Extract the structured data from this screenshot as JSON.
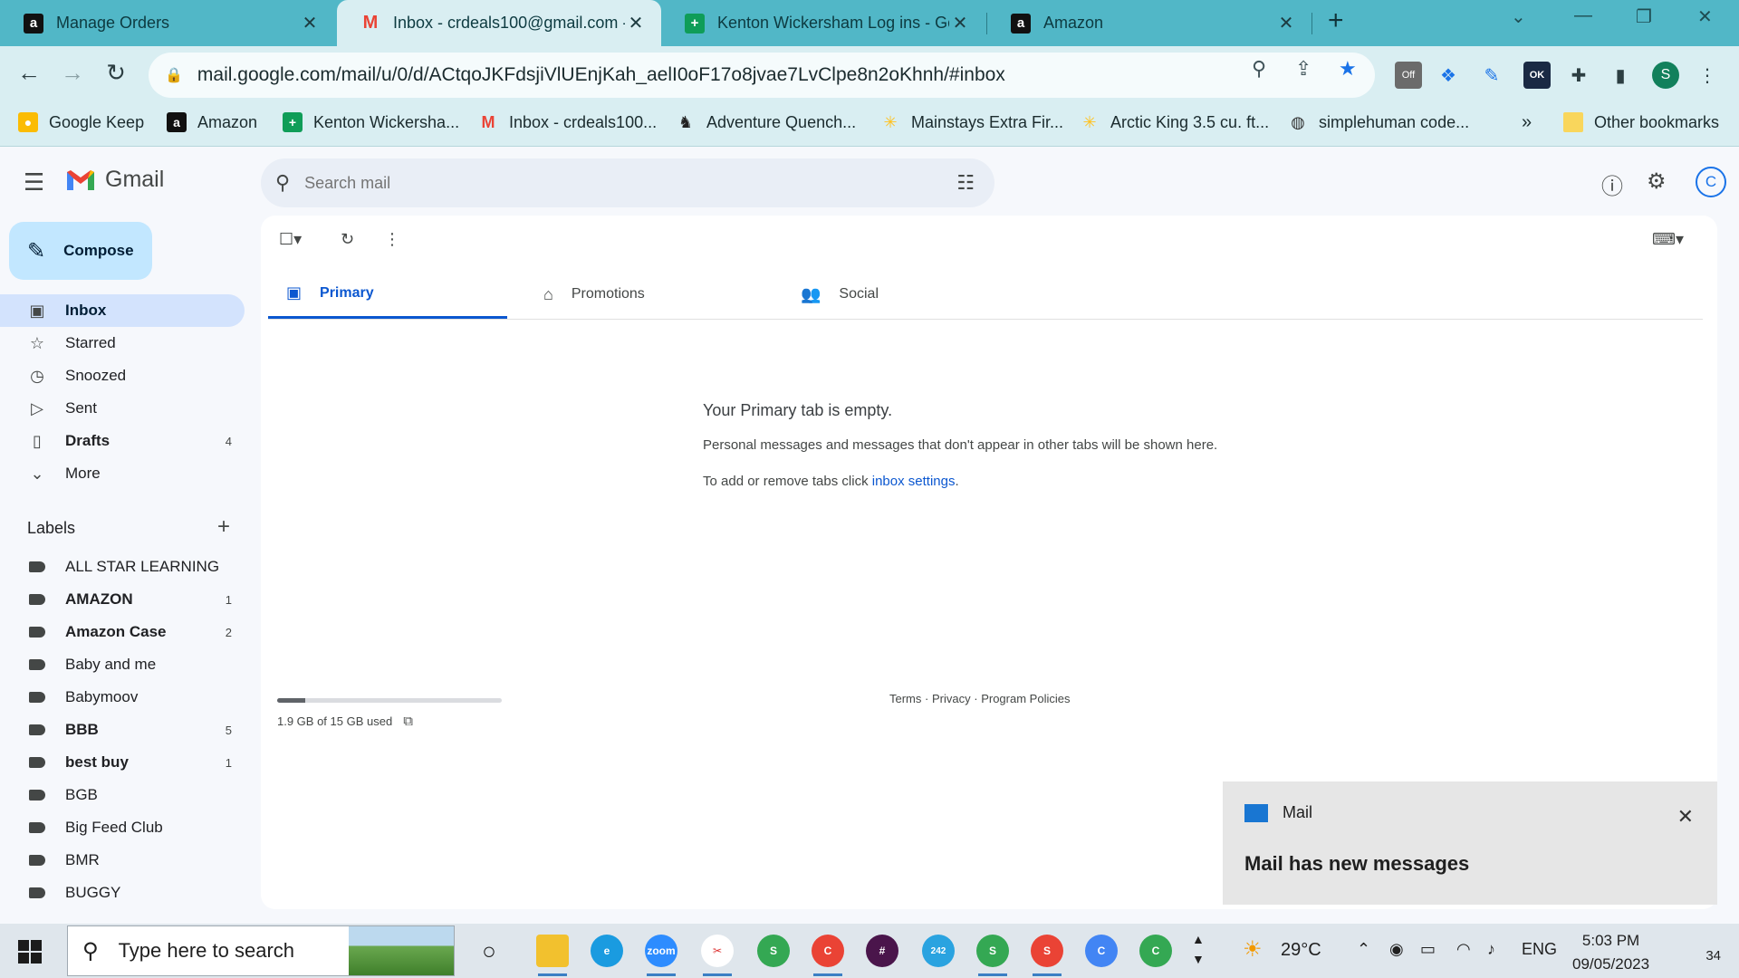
{
  "browser": {
    "tabs": [
      {
        "title": "Manage Orders",
        "icon": "amazon-icon",
        "close": "✕"
      },
      {
        "title": "Inbox - crdeals100@gmail.com -",
        "icon": "gmail-icon",
        "close": "✕"
      },
      {
        "title": "Kenton Wickersham Log ins - Go",
        "icon": "sheets-icon",
        "close": "✕"
      },
      {
        "title": "Amazon",
        "icon": "amazon-icon",
        "close": "✕"
      }
    ],
    "active_tab_index": 1,
    "url": "mail.google.com/mail/u/0/d/ACtqoJKFdsjiVlUEnjKah_aelI0oF17o8jvae7LvClpe8n2oKhnh/#inbox",
    "profile_initial": "S",
    "ext_off_label": "Off",
    "ext_ok_label": "OK",
    "bookmarks": [
      {
        "label": "Google Keep",
        "icon": "keep-icon"
      },
      {
        "label": "Amazon",
        "icon": "amazon-icon"
      },
      {
        "label": "Kenton Wickersha...",
        "icon": "sheets-icon"
      },
      {
        "label": "Inbox - crdeals100...",
        "icon": "gmail-icon"
      },
      {
        "label": "Adventure Quench...",
        "icon": "deer-icon"
      },
      {
        "label": "Mainstays Extra Fir...",
        "icon": "walmart-icon"
      },
      {
        "label": "Arctic King 3.5 cu. ft...",
        "icon": "walmart-icon"
      },
      {
        "label": "simplehuman code...",
        "icon": "globe-icon"
      }
    ],
    "bookmarks_overflow": "»",
    "other_bookmarks": "Other bookmarks"
  },
  "gmail": {
    "logo_text": "Gmail",
    "search_placeholder": "Search mail",
    "avatar_initial": "C",
    "compose_label": "Compose",
    "nav": [
      {
        "label": "Inbox",
        "icon": "inbox-icon",
        "count": "",
        "active": true,
        "bold": true
      },
      {
        "label": "Starred",
        "icon": "star-icon",
        "count": "",
        "active": false,
        "bold": false
      },
      {
        "label": "Snoozed",
        "icon": "clock-icon",
        "count": "",
        "active": false,
        "bold": false
      },
      {
        "label": "Sent",
        "icon": "send-icon",
        "count": "",
        "active": false,
        "bold": false
      },
      {
        "label": "Drafts",
        "icon": "draft-icon",
        "count": "4",
        "active": false,
        "bold": true
      },
      {
        "label": "More",
        "icon": "chevron-down-icon",
        "count": "",
        "active": false,
        "bold": false
      }
    ],
    "labels_heading": "Labels",
    "labels": [
      {
        "label": "ALL STAR LEARNING",
        "count": "",
        "bold": false
      },
      {
        "label": "AMAZON",
        "count": "1",
        "bold": true
      },
      {
        "label": "Amazon Case",
        "count": "2",
        "bold": true
      },
      {
        "label": "Baby and me",
        "count": "",
        "bold": false
      },
      {
        "label": "Babymoov",
        "count": "",
        "bold": false
      },
      {
        "label": "BBB",
        "count": "5",
        "bold": true
      },
      {
        "label": "best buy",
        "count": "1",
        "bold": true
      },
      {
        "label": "BGB",
        "count": "",
        "bold": false
      },
      {
        "label": "Big Feed Club",
        "count": "",
        "bold": false
      },
      {
        "label": "BMR",
        "count": "",
        "bold": false
      },
      {
        "label": "BUGGY",
        "count": "",
        "bold": false
      }
    ],
    "categories": [
      {
        "label": "Primary",
        "icon": "inbox-icon",
        "active": true
      },
      {
        "label": "Promotions",
        "icon": "tag-icon",
        "active": false
      },
      {
        "label": "Social",
        "icon": "people-icon",
        "active": false
      }
    ],
    "empty_title": "Your Primary tab is empty.",
    "empty_desc": "Personal messages and messages that don't appear in other tabs will be shown here.",
    "empty_hint_prefix": "To add or remove tabs click",
    "empty_hint_link": "inbox settings",
    "empty_hint_suffix": ".",
    "storage_text": "1.9 GB of 15 GB used",
    "storage_fraction": 0.127,
    "footer_terms": "Terms",
    "footer_privacy": "Privacy",
    "footer_policies": "Program Policies",
    "footer_sep": "·"
  },
  "toast": {
    "app": "Mail",
    "message": "Mail has new messages"
  },
  "taskbar": {
    "search_placeholder": "Type here to search",
    "zoom_label": "zoom",
    "telegram_badge": "242",
    "weather": "29°C",
    "language": "ENG",
    "time": "5:03 PM",
    "date": "09/05/2023",
    "notification_count": "34"
  },
  "colors": {
    "tabstrip": "#51b7c7",
    "toolbar": "#d9eef2",
    "accent": "#0b57d0",
    "compose_bg": "#c2e7ff",
    "inbox_active": "#d3e3fd"
  }
}
